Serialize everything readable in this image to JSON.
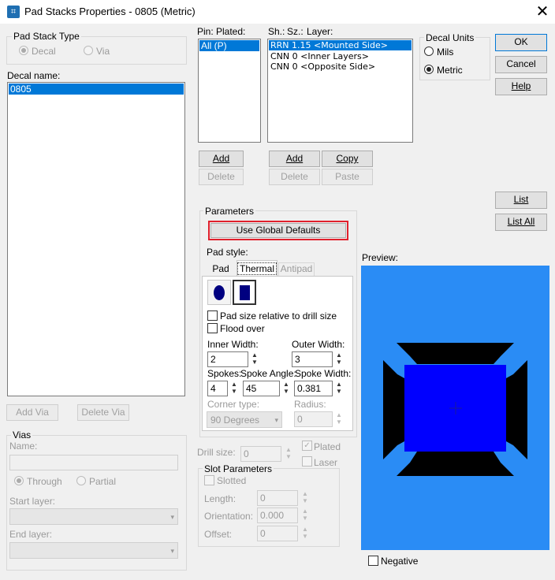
{
  "window": {
    "title": "Pad Stacks Properties - 0805 (Metric)",
    "app_icon": "padstack-app-icon",
    "close_glyph": "✕"
  },
  "pad_stack_type": {
    "label": "Pad Stack Type",
    "options": [
      "Decal",
      "Via"
    ],
    "selected": "Decal"
  },
  "decal_name": {
    "label": "Decal name:",
    "items": [
      "0805"
    ],
    "selected": "0805"
  },
  "decal_buttons": {
    "add_via": "Add Via",
    "delete_via": "Delete Via"
  },
  "vias": {
    "label": "Vias",
    "name_label": "Name:",
    "name_value": "",
    "through": "Through",
    "partial": "Partial",
    "selected": "Through",
    "start_layer_label": "Start layer:",
    "end_layer_label": "End layer:"
  },
  "pin_list": {
    "header_pin": "Pin:",
    "header_plated": "Plated:",
    "items": [
      "All (P)"
    ],
    "selected": "All (P)",
    "add": "Add",
    "delete": "Delete"
  },
  "layer_list": {
    "header_sh": "Sh.:",
    "header_sz": "Sz.:",
    "header_layer": "Layer:",
    "items": [
      "RRN 1.15 <Mounted Side>",
      "CNN 0 <Inner Layers>",
      "CNN 0 <Opposite Side>"
    ],
    "selected": "RRN 1.15 <Mounted Side>",
    "add": "Add",
    "copy": "Copy",
    "delete": "Delete",
    "paste": "Paste"
  },
  "decal_units": {
    "label": "Decal Units",
    "options": [
      "Mils",
      "Metric"
    ],
    "selected": "Metric"
  },
  "dialog_buttons": {
    "ok": "OK",
    "cancel": "Cancel",
    "help": "Help",
    "list": "List",
    "list_all": "List All"
  },
  "parameters": {
    "label": "Parameters",
    "use_global_defaults": "Use Global Defaults",
    "pad_style_label": "Pad style:",
    "tabs": [
      "Pad",
      "Thermal",
      "Antipad"
    ],
    "active_tab": "Thermal",
    "pad_size_relative": "Pad size relative to drill size",
    "flood_over": "Flood over",
    "inner_width_label": "Inner Width:",
    "inner_width": "2",
    "outer_width_label": "Outer Width:",
    "outer_width": "3",
    "spokes_label": "Spokes:",
    "spokes": "4",
    "spoke_angle_label": "Spoke Angle:",
    "spoke_angle": "45",
    "spoke_width_label": "Spoke Width:",
    "spoke_width": "0.381",
    "corner_type_label": "Corner type:",
    "corner_type": "90 Degrees",
    "radius_label": "Radius:",
    "radius": "0"
  },
  "drill": {
    "size_label": "Drill size:",
    "size": "0",
    "plated": "Plated",
    "laser": "Laser"
  },
  "slot": {
    "label": "Slot Parameters",
    "slotted": "Slotted",
    "length_label": "Length:",
    "length": "0",
    "orientation_label": "Orientation:",
    "orientation": "0.000",
    "offset_label": "Offset:",
    "offset": "0"
  },
  "preview": {
    "label": "Preview:",
    "negative": "Negative",
    "colors": {
      "background": "#2a8cf5",
      "pad": "#0000ff",
      "thermal": "#000000"
    }
  },
  "colors": {
    "selection": "#0078d7",
    "highlight_border": "#e0202c"
  }
}
